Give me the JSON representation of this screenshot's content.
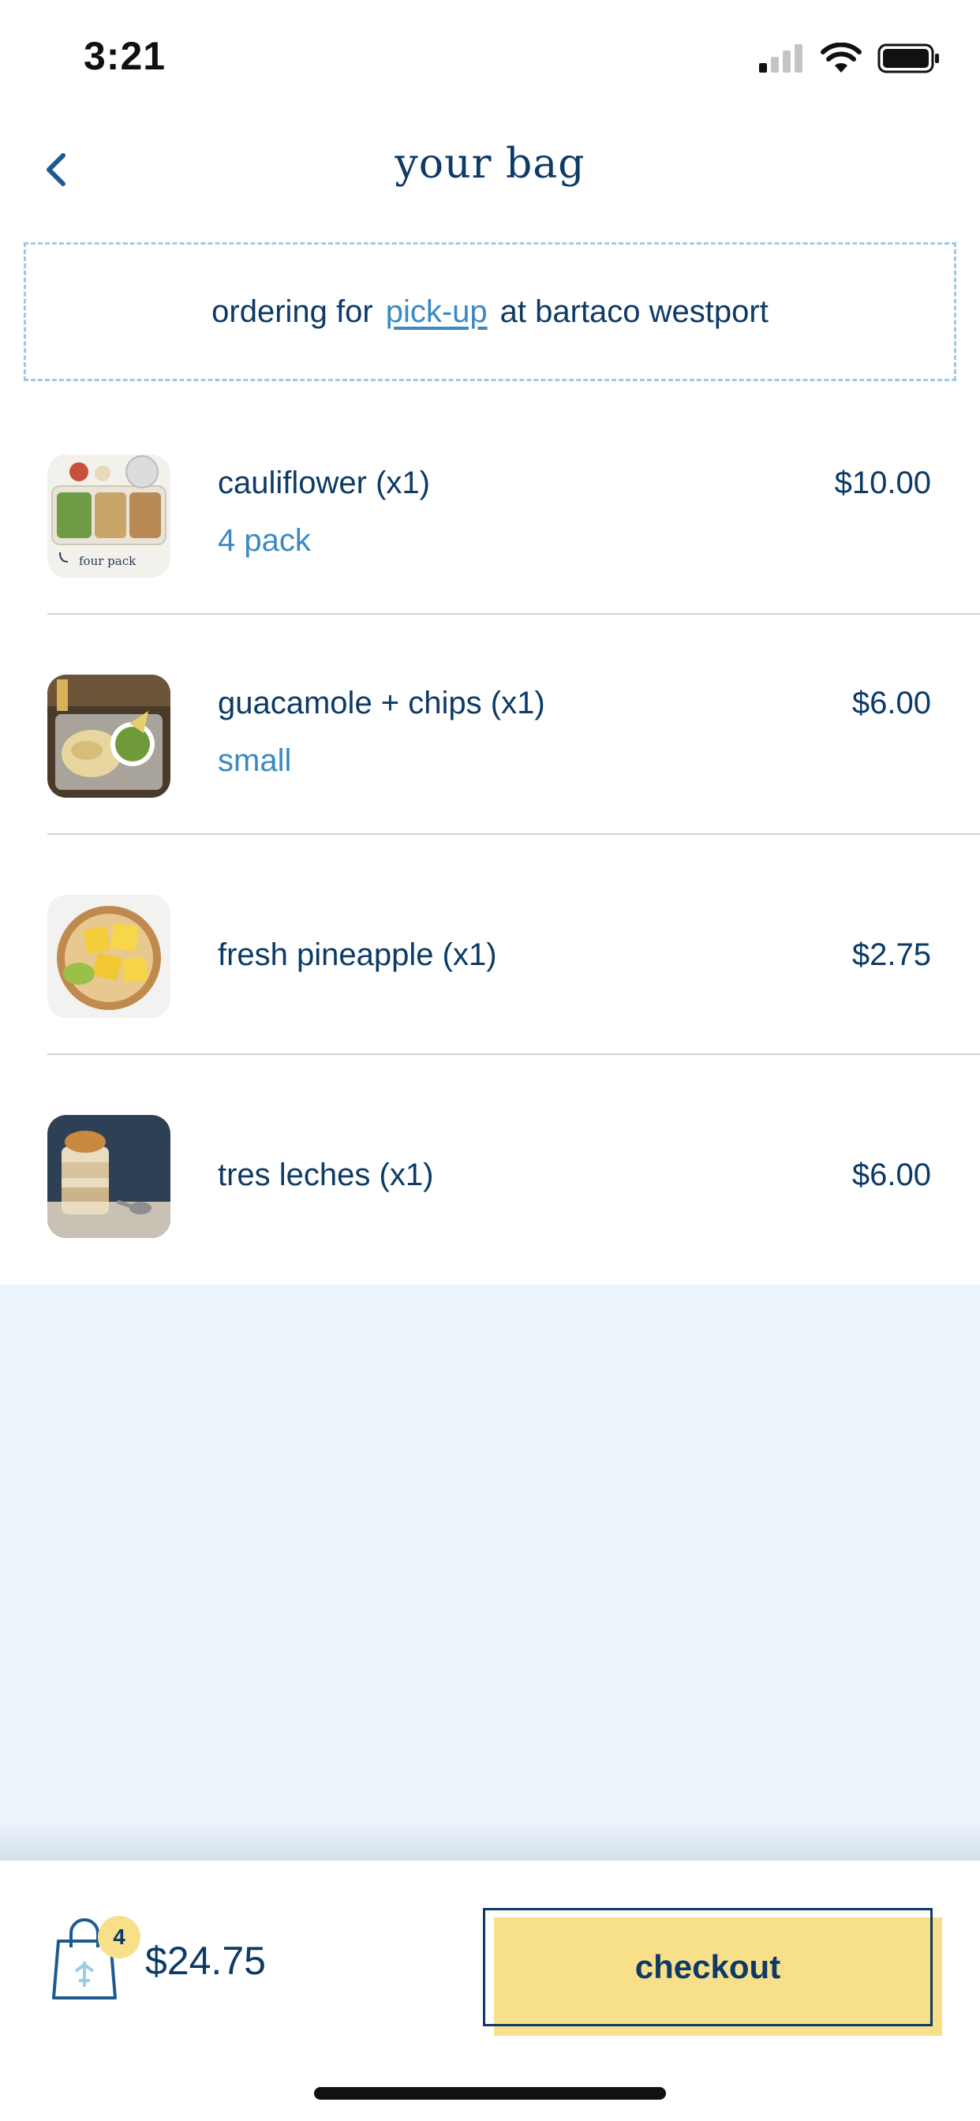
{
  "status_bar": {
    "time": "3:21"
  },
  "header": {
    "title": "your bag"
  },
  "pickup": {
    "prefix": "ordering for",
    "mode": "pick-up",
    "suffix": "at bartaco westport"
  },
  "items": [
    {
      "name": "cauliflower (x1)",
      "option": "4 pack",
      "price": "$10.00",
      "thumb_caption": "four pack"
    },
    {
      "name": "guacamole + chips (x1)",
      "option": "small",
      "price": "$6.00"
    },
    {
      "name": "fresh pineapple (x1)",
      "price": "$2.75"
    },
    {
      "name": "tres leches (x1)",
      "price": "$6.00"
    }
  ],
  "cart": {
    "count": "4",
    "total": "$24.75"
  },
  "checkout": {
    "label": "checkout"
  },
  "colors": {
    "primary_text": "#0d3a66",
    "accent_blue": "#3a8ac1",
    "banner_border": "#9ccbe6",
    "empty_bg": "#ecf4fb",
    "checkout_yellow": "#f8e08a"
  },
  "icons": [
    "back-chevron-icon",
    "signal-icon",
    "wifi-icon",
    "battery-icon",
    "shopping-bag-icon"
  ]
}
